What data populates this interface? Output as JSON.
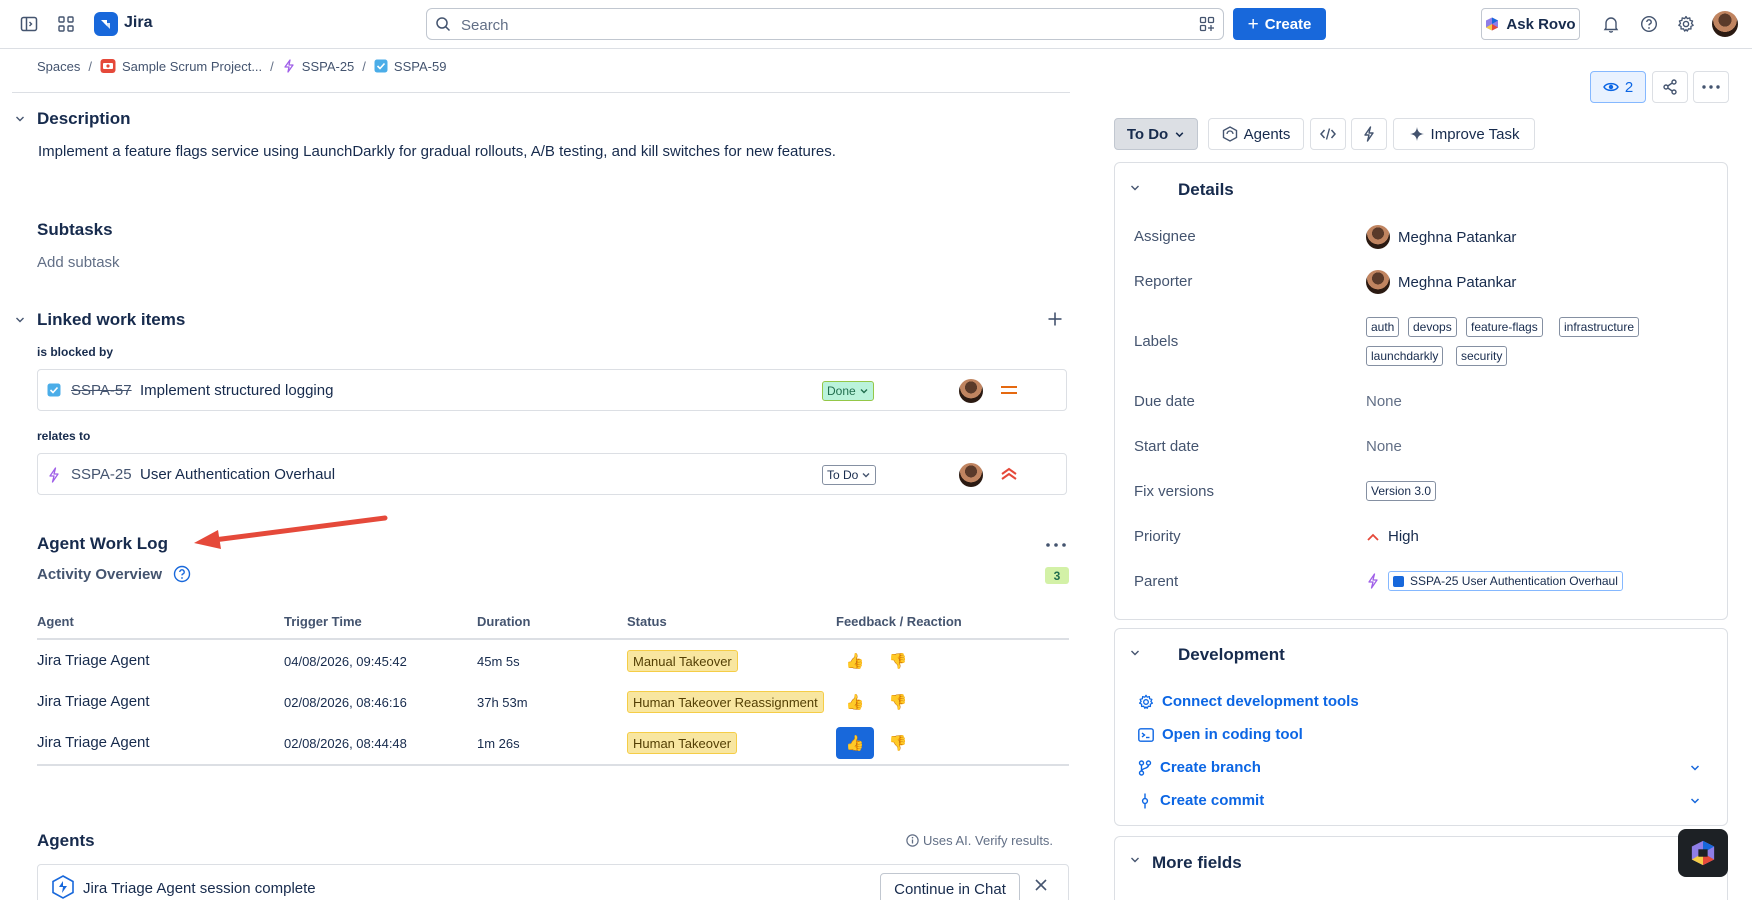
{
  "topbar": {
    "app_name": "Jira",
    "search_placeholder": "Search",
    "create_label": "Create",
    "ask_rovo_label": "Ask Rovo"
  },
  "breadcrumb": {
    "spaces": "Spaces",
    "project": "Sample Scrum Project...",
    "epic": "SSPA-25",
    "task": "SSPA-59"
  },
  "description": {
    "heading": "Description",
    "text": "Implement a feature flags service using LaunchDarkly for gradual rollouts, A/B testing, and kill switches for new features."
  },
  "subtasks": {
    "heading": "Subtasks",
    "add_label": "Add subtask"
  },
  "linked": {
    "heading": "Linked work items",
    "groups": [
      {
        "label": "is blocked by",
        "key": "SSPA-57",
        "title": "Implement structured logging",
        "status": "Done"
      },
      {
        "label": "relates to",
        "key": "SSPA-25",
        "title": "User Authentication Overhaul",
        "status": "To Do"
      }
    ]
  },
  "agent_work_log": {
    "heading": "Agent Work Log",
    "subheading": "Activity Overview",
    "count": "3",
    "columns": [
      "Agent",
      "Trigger Time",
      "Duration",
      "Status",
      "Feedback / Reaction"
    ],
    "rows": [
      {
        "agent": "Jira Triage Agent",
        "time": "04/08/2026, 09:45:42",
        "duration": "45m 5s",
        "status": "Manual Takeover",
        "liked": false
      },
      {
        "agent": "Jira Triage Agent",
        "time": "02/08/2026, 08:46:16",
        "duration": "37h 53m",
        "status": "Human Takeover Reassignment",
        "liked": false
      },
      {
        "agent": "Jira Triage Agent",
        "time": "02/08/2026, 08:44:48",
        "duration": "1m 26s",
        "status": "Human Takeover",
        "liked": true
      }
    ]
  },
  "agents": {
    "heading": "Agents",
    "ai_note": "Uses AI. Verify results.",
    "card_text": "Jira Triage Agent session complete",
    "continue_label": "Continue in Chat"
  },
  "header_actions": {
    "watchers": "2",
    "status": "To Do",
    "agents_label": "Agents",
    "improve_label": "Improve Task"
  },
  "details": {
    "heading": "Details",
    "assignee_label": "Assignee",
    "assignee": "Meghna Patankar",
    "reporter_label": "Reporter",
    "reporter": "Meghna Patankar",
    "labels_label": "Labels",
    "labels": [
      "auth",
      "devops",
      "feature-flags",
      "infrastructure",
      "launchdarkly",
      "security"
    ],
    "due_label": "Due date",
    "due": "None",
    "start_label": "Start date",
    "start": "None",
    "fix_label": "Fix versions",
    "fix": "Version 3.0",
    "priority_label": "Priority",
    "priority": "High",
    "parent_label": "Parent",
    "parent": "SSPA-25 User Authentication Overhaul"
  },
  "development": {
    "heading": "Development",
    "links": [
      "Connect development tools",
      "Open in coding tool",
      "Create branch",
      "Create commit"
    ]
  },
  "more_fields": {
    "heading": "More fields"
  },
  "colors": {
    "brand": "#1868DB",
    "annotation_arrow": "#E5493A"
  }
}
